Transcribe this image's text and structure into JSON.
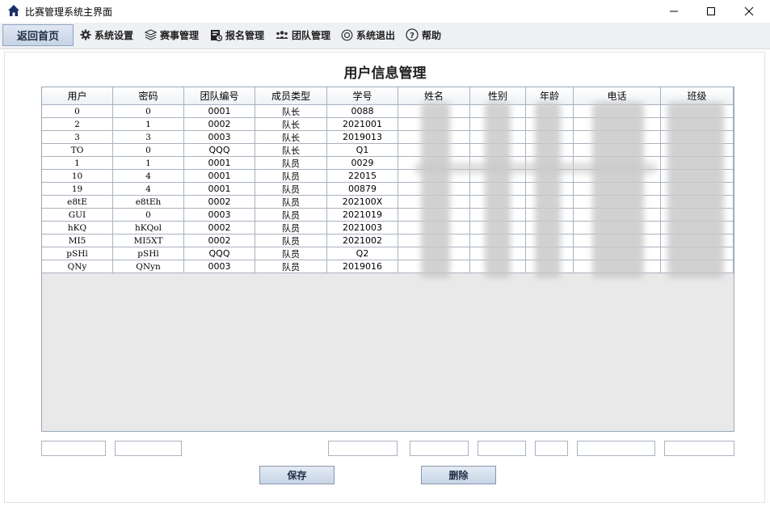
{
  "window": {
    "title": "比赛管理系统主界面"
  },
  "menubar": {
    "home_label": "返回首页",
    "items": [
      {
        "label": "系统设置",
        "icon": "gear-icon"
      },
      {
        "label": "赛事管理",
        "icon": "layers-icon"
      },
      {
        "label": "报名管理",
        "icon": "registration-icon"
      },
      {
        "label": "团队管理",
        "icon": "team-icon"
      },
      {
        "label": "系统退出",
        "icon": "power-icon"
      },
      {
        "label": "帮助",
        "icon": "help-icon"
      }
    ]
  },
  "page": {
    "title": "用户信息管理"
  },
  "table": {
    "columns": [
      "用户",
      "密码",
      "团队编号",
      "成员类型",
      "学号",
      "姓名",
      "性别",
      "年龄",
      "电话",
      "班级"
    ],
    "rows": [
      [
        "0",
        "0",
        "0001",
        "队长",
        "0088",
        "",
        "",
        "",
        "",
        ""
      ],
      [
        "2",
        "1",
        "0002",
        "队长",
        "2021001",
        "",
        "",
        "",
        "",
        ""
      ],
      [
        "3",
        "3",
        "0003",
        "队长",
        "2019013",
        "",
        "",
        "",
        "",
        ""
      ],
      [
        "TO",
        "0",
        "QQQ",
        "队长",
        "Q1",
        "",
        "",
        "",
        "",
        ""
      ],
      [
        "1",
        "1",
        "0001",
        "队员",
        "0029",
        "",
        "",
        "",
        "",
        ""
      ],
      [
        "10",
        "4",
        "0001",
        "队员",
        "22015",
        "",
        "",
        "",
        "",
        ""
      ],
      [
        "19",
        "4",
        "0001",
        "队员",
        "00879",
        "",
        "",
        "",
        "",
        ""
      ],
      [
        "e8tE",
        "e8tEh",
        "0002",
        "队员",
        "202100X",
        "",
        "",
        "",
        "",
        ""
      ],
      [
        "GUI",
        "0",
        "0003",
        "队员",
        "2021019",
        "",
        "",
        "",
        "",
        ""
      ],
      [
        "hKQ",
        "hKQol",
        "0002",
        "队员",
        "2021003",
        "",
        "",
        "",
        "",
        ""
      ],
      [
        "MI5",
        "MI5XT",
        "0002",
        "队员",
        "2021002",
        "",
        "",
        "",
        "",
        ""
      ],
      [
        "pSHl",
        "pSHl",
        "QQQ",
        "队员",
        "Q2",
        "",
        "",
        "",
        "",
        ""
      ],
      [
        "QNy",
        "QNyn",
        "0003",
        "队员",
        "2019016",
        "",
        "",
        "",
        "",
        ""
      ]
    ]
  },
  "form": {
    "save_label": "保存",
    "delete_label": "删除"
  }
}
